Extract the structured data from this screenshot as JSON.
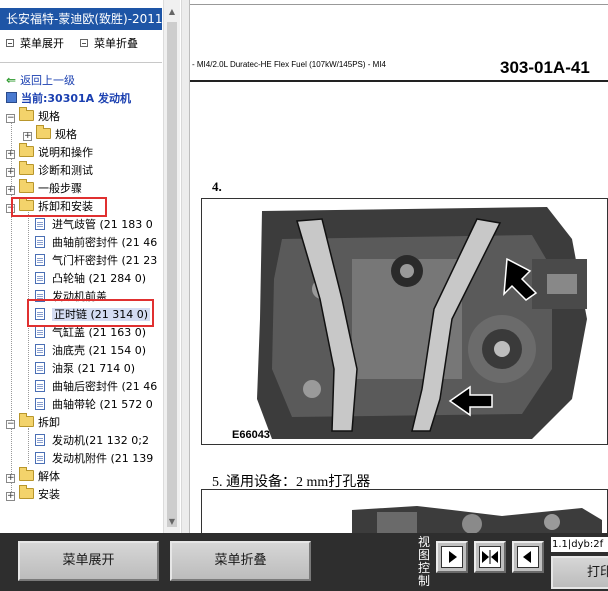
{
  "window": {
    "title": "长安福特-蒙迪欧(致胜)-2011"
  },
  "sidebar": {
    "expand_all": "菜单展开",
    "collapse_all": "菜单折叠",
    "back_link": "返回上一级",
    "current": "当前:30301A 发动机",
    "tree": [
      {
        "label": "规格",
        "level": 0,
        "type": "folder",
        "expander": "−"
      },
      {
        "label": "规格",
        "level": 1,
        "type": "folder",
        "expander": "+"
      },
      {
        "label": "说明和操作",
        "level": 0,
        "type": "folder",
        "expander": "+"
      },
      {
        "label": "诊断和测试",
        "level": 0,
        "type": "folder",
        "expander": "+"
      },
      {
        "label": "一般步骤",
        "level": 0,
        "type": "folder",
        "expander": "+"
      },
      {
        "label": "拆卸和安装",
        "level": 0,
        "type": "folder",
        "expander": "−",
        "highlighted": true
      },
      {
        "label": "进气歧管 (21 183 0",
        "level": 1,
        "type": "doc"
      },
      {
        "label": "曲轴前密封件 (21 46",
        "level": 1,
        "type": "doc"
      },
      {
        "label": "气门杆密封件 (21 23",
        "level": 1,
        "type": "doc"
      },
      {
        "label": "凸轮轴 (21 284 0)",
        "level": 1,
        "type": "doc"
      },
      {
        "label": "发动机前盖",
        "level": 1,
        "type": "doc"
      },
      {
        "label": "正时链 (21 314 0)",
        "level": 1,
        "type": "doc",
        "selected": true,
        "highlighted": true
      },
      {
        "label": "气缸盖 (21 163 0)",
        "level": 1,
        "type": "doc"
      },
      {
        "label": "油底壳 (21 154 0)",
        "level": 1,
        "type": "doc"
      },
      {
        "label": "油泵 (21 714 0)",
        "level": 1,
        "type": "doc"
      },
      {
        "label": "曲轴后密封件 (21 46",
        "level": 1,
        "type": "doc"
      },
      {
        "label": "曲轴带轮 (21 572 0",
        "level": 1,
        "type": "doc"
      },
      {
        "label": "拆卸",
        "level": 0,
        "type": "folder",
        "expander": "−"
      },
      {
        "label": "发动机(21 132 0;2",
        "level": 1,
        "type": "doc"
      },
      {
        "label": "发动机附件 (21 139",
        "level": 1,
        "type": "doc"
      },
      {
        "label": "解体",
        "level": 0,
        "type": "folder",
        "expander": "+"
      },
      {
        "label": "安装",
        "level": 0,
        "type": "folder",
        "expander": "+"
      }
    ]
  },
  "document": {
    "header_left": "- MI4/2.0L Duratec-HE Flex Fuel (107kW/145PS) - MI4",
    "header_right": "303-01A-41",
    "step4": "4.",
    "figure1_caption": "E66043",
    "step5": "5.  通用设备：2 mm打孔器"
  },
  "toolbar": {
    "expand_button": "菜单展开",
    "collapse_button": "菜单折叠",
    "view_control_label": "视图控制",
    "status_text": "1.1|dyb:2f",
    "print_button": "打印"
  },
  "colors": {
    "title_bar": "#1e55a6",
    "highlight_box": "#e03030",
    "link": "#1a3fb0",
    "toolbar_bg": "#2e2e2e"
  }
}
